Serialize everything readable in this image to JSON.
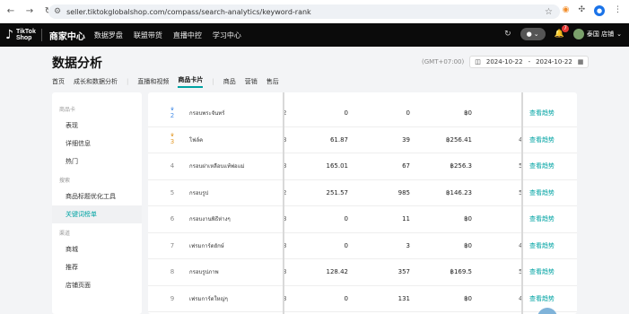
{
  "browser": {
    "url": "seller.tiktokglobalshop.com/compass/search-analytics/keyword-rank",
    "back_icon": "arrow-left-icon",
    "forward_icon": "arrow-right-icon",
    "reload_icon": "reload-icon",
    "bookmark_icon": "star-icon"
  },
  "header": {
    "logo_line1": "TikTok",
    "logo_line2": "Shop",
    "merchant_center": "商家中心",
    "nav": [
      "数据罗盘",
      "联盟带货",
      "直播中控",
      "学习中心"
    ],
    "notification_count": "7",
    "shop_name": "泰国 店铺"
  },
  "page": {
    "title": "数据分析",
    "timezone": "(GMT+07:00)",
    "date_start": "2024-10-22",
    "date_sep": "-",
    "date_end": "2024-10-22",
    "tabs": [
      "首页",
      "成长和数据分析",
      "直播和视频",
      "商品卡片",
      "商品",
      "营销",
      "售后"
    ],
    "active_tab": "商品卡片"
  },
  "sidebar": {
    "groups": [
      {
        "title": "商品卡",
        "items": [
          "表现",
          "详细信息",
          "热门"
        ]
      },
      {
        "title": "搜索",
        "items": [
          "商品标题优化工具",
          "关键词榜单"
        ]
      },
      {
        "title": "渠道",
        "items": [
          "商城",
          "推荐",
          "店铺页面"
        ]
      }
    ],
    "active_item": "关键词榜单"
  },
  "table": {
    "link_label": "查看趋势",
    "rows": [
      {
        "rank": "2",
        "crown": "orange",
        "keyword": "กรอบพระจันทร์",
        "left_clip": "2",
        "search_volume": "0",
        "clicks": "0",
        "gmv": "฿0",
        "right_clip": "",
        "link": "查看趋势"
      },
      {
        "rank": "3",
        "crown": "orange",
        "keyword": "โฟล์ค",
        "left_clip": "3",
        "search_volume": "61.87",
        "clicks": "39",
        "gmv": "฿256.41",
        "right_clip": "4",
        "link": "查看趋势"
      },
      {
        "rank": "4",
        "crown": "",
        "keyword": "กรอบฝาเหลือบแท้พ่อแม่",
        "left_clip": "3",
        "search_volume": "165.01",
        "clicks": "67",
        "gmv": "฿256.3",
        "right_clip": "5",
        "link": "查看趋势"
      },
      {
        "rank": "5",
        "crown": "",
        "keyword": "กรอบรูป",
        "left_clip": "2",
        "search_volume": "251.57",
        "clicks": "985",
        "gmv": "฿146.23",
        "right_clip": "5",
        "link": "查看趋势"
      },
      {
        "rank": "6",
        "crown": "",
        "keyword": "กรอบงานพิธีห่างๆ",
        "left_clip": "3",
        "search_volume": "0",
        "clicks": "11",
        "gmv": "฿0",
        "right_clip": "",
        "link": "查看趋势"
      },
      {
        "rank": "7",
        "crown": "",
        "keyword": "เฟรมการ์ดยักษ์",
        "left_clip": "3",
        "search_volume": "0",
        "clicks": "3",
        "gmv": "฿0",
        "right_clip": "4",
        "link": "查看趋势"
      },
      {
        "rank": "8",
        "crown": "",
        "keyword": "กรอบรูปภาพ",
        "left_clip": "3",
        "search_volume": "128.42",
        "clicks": "357",
        "gmv": "฿169.5",
        "right_clip": "5",
        "link": "查看趋势"
      },
      {
        "rank": "9",
        "crown": "",
        "keyword": "เฟรมการ์ดใหญ่ๆ",
        "left_clip": "3",
        "search_volume": "0",
        "clicks": "131",
        "gmv": "฿0",
        "right_clip": "4",
        "link": "查看趋势"
      }
    ]
  }
}
